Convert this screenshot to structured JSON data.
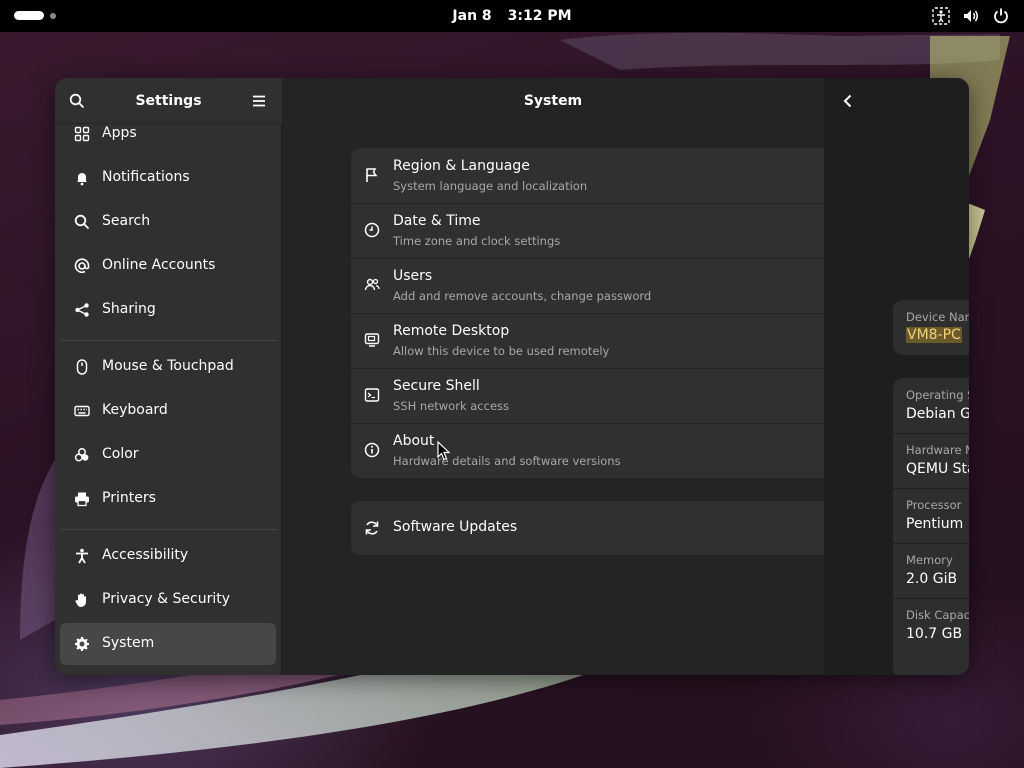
{
  "topbar": {
    "date": "Jan 8",
    "time": "3:12 PM",
    "icons": [
      "accessibility-tray-icon",
      "volume-icon",
      "power-icon"
    ]
  },
  "sidebar": {
    "title": "Settings",
    "search_icon": "search-icon",
    "menu_icon": "hamburger-menu-icon",
    "items": [
      {
        "label": "Apps",
        "icon": "apps-grid-icon"
      },
      {
        "label": "Notifications",
        "icon": "bell-icon"
      },
      {
        "label": "Search",
        "icon": "search-icon"
      },
      {
        "label": "Online Accounts",
        "icon": "at-sign-icon"
      },
      {
        "label": "Sharing",
        "icon": "share-icon"
      },
      {
        "label": "Mouse & Touchpad",
        "icon": "mouse-icon"
      },
      {
        "label": "Keyboard",
        "icon": "keyboard-icon"
      },
      {
        "label": "Color",
        "icon": "color-icon"
      },
      {
        "label": "Printers",
        "icon": "printer-icon"
      },
      {
        "label": "Accessibility",
        "icon": "accessibility-icon"
      },
      {
        "label": "Privacy & Security",
        "icon": "hand-icon"
      },
      {
        "label": "System",
        "icon": "gear-icon",
        "selected": true
      }
    ]
  },
  "main": {
    "title": "System",
    "rows": [
      {
        "title": "Region & Language",
        "subtitle": "System language and localization",
        "icon": "flag-icon"
      },
      {
        "title": "Date & Time",
        "subtitle": "Time zone and clock settings",
        "icon": "clock-icon"
      },
      {
        "title": "Users",
        "subtitle": "Add and remove accounts, change password",
        "icon": "users-icon"
      },
      {
        "title": "Remote Desktop",
        "subtitle": "Allow this device to be used remotely",
        "icon": "remote-desktop-icon"
      },
      {
        "title": "Secure Shell",
        "subtitle": "SSH network access",
        "icon": "terminal-icon"
      },
      {
        "title": "About",
        "subtitle": "Hardware details and software versions",
        "icon": "info-icon"
      }
    ],
    "updates": {
      "title": "Software Updates",
      "icon": "refresh-icon"
    }
  },
  "detail": {
    "back_icon": "back-arrow-icon",
    "device_name": {
      "label": "Device Nam",
      "value": "VM8-PC"
    },
    "properties": [
      {
        "label": "Operating S",
        "value": "Debian GN"
      },
      {
        "label": "Hardware M",
        "value": "QEMU Sta"
      },
      {
        "label": "Processor",
        "value": "Pentium I"
      },
      {
        "label": "Memory",
        "value": "2.0 GiB"
      },
      {
        "label": "Disk Capaci",
        "value": "10.7 GB"
      }
    ]
  },
  "colors": {
    "topbar": "#000000",
    "sidebar": "#303030",
    "content": "#242424",
    "detail": "#1e1e1e",
    "selected": "#474747",
    "highlight": "#6b5a2a"
  }
}
